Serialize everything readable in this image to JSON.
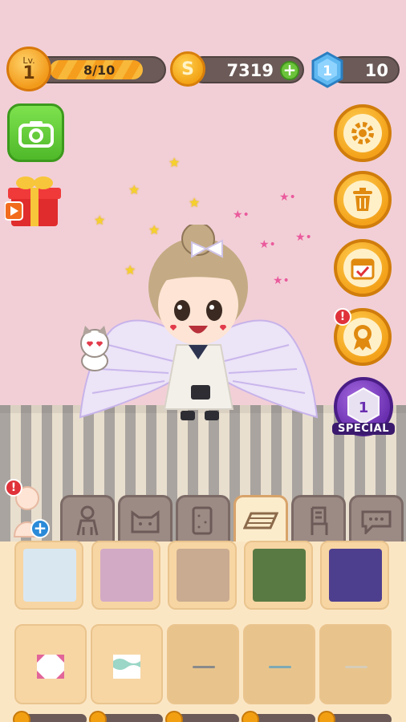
{
  "hud": {
    "level_prefix": "Lv.",
    "level": "1",
    "xp_text": "8/10",
    "xp_progress": 0.8,
    "coin_symbol": "S",
    "coins": "7319",
    "coin_plus": "+",
    "gem_level": "1",
    "gems": "10"
  },
  "left_buttons": {
    "camera": "camera-icon",
    "gift": "gift-video-icon"
  },
  "right_buttons": [
    {
      "name": "settings",
      "icon": "gear-icon"
    },
    {
      "name": "delete",
      "icon": "trash-icon"
    },
    {
      "name": "calendar",
      "icon": "calendar-check-icon"
    },
    {
      "name": "achievements",
      "icon": "ribbon-badge-icon",
      "alert": "!"
    },
    {
      "name": "special",
      "icon": "special-badge-icon",
      "number": "1",
      "label": "SPECIAL"
    }
  ],
  "avatar": {
    "alert": "!",
    "plus": "+"
  },
  "tabs": [
    {
      "name": "body",
      "icon": "person-icon",
      "active": false
    },
    {
      "name": "pets",
      "icon": "cat-icon",
      "active": false
    },
    {
      "name": "wallpaper",
      "icon": "wallpaper-icon",
      "active": false
    },
    {
      "name": "floor",
      "icon": "floor-icon",
      "active": true
    },
    {
      "name": "furniture",
      "icon": "chair-icon",
      "active": false
    },
    {
      "name": "speech",
      "icon": "speech-bubble-icon",
      "active": false
    }
  ],
  "swatches": [
    "#d9e7f1",
    "#d3aac6",
    "#c9ab91",
    "#5a7a44",
    "#4e3f8e"
  ],
  "patterns": [
    "pink-pattern",
    "mint-pattern",
    "gray-stripe",
    "teal-stripe",
    "beige-stripe"
  ],
  "colors": {
    "wall": "#f2cfd7",
    "accent_orange": "#f3a21a",
    "panel": "#fbe6c4"
  }
}
